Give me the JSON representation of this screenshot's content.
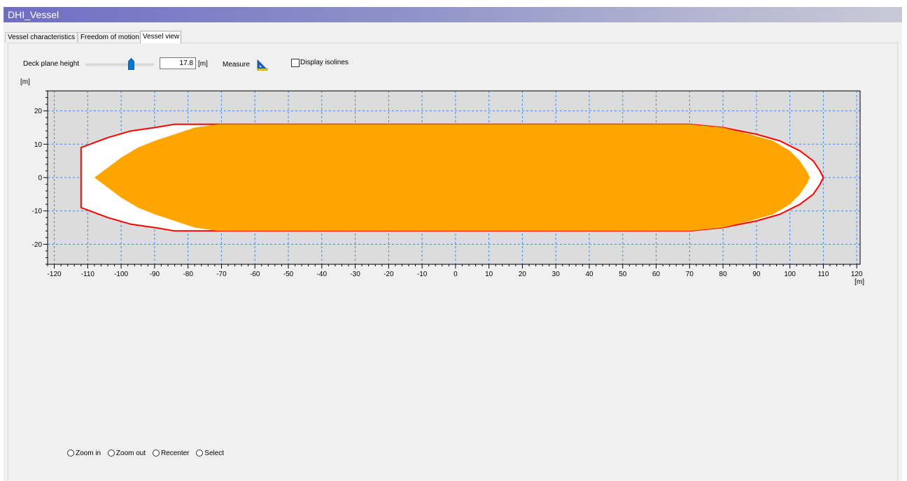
{
  "window": {
    "title": "DHI_Vessel"
  },
  "tabs": [
    {
      "label": "Vessel characteristics",
      "active": false
    },
    {
      "label": "Freedom of motion",
      "active": false
    },
    {
      "label": "Vessel view",
      "active": true
    }
  ],
  "controls": {
    "deck_plane_label": "Deck plane height",
    "deck_plane_value": "17.8",
    "deck_plane_unit": "[m]",
    "measure_label": "Measure",
    "display_isolines_label": "Display isolines",
    "display_isolines_checked": false
  },
  "chart_data": {
    "type": "area",
    "x_unit": "[m]",
    "y_unit": "[m]",
    "xlim": [
      -122,
      121
    ],
    "ylim": [
      -26,
      26
    ],
    "x_ticks": [
      "-120",
      "-110",
      "-100",
      "-90",
      "-80",
      "-70",
      "-60",
      "-50",
      "-40",
      "-30",
      "-20",
      "-10",
      "0",
      "10",
      "20",
      "30",
      "40",
      "50",
      "60",
      "70",
      "80",
      "90",
      "100",
      "110",
      "120"
    ],
    "y_ticks": [
      "20",
      "10",
      "0",
      "-10",
      "-20"
    ],
    "grid": true,
    "background": "#dcdcdc",
    "outline_color": "#ff0000",
    "fill_color": "#ffa500",
    "hull_outline": [
      [
        -112,
        9
      ],
      [
        -104,
        12
      ],
      [
        -97,
        14
      ],
      [
        -90,
        15
      ],
      [
        -84,
        16
      ],
      [
        -76,
        16
      ],
      [
        -60,
        16
      ],
      [
        0,
        16
      ],
      [
        32,
        16
      ],
      [
        52,
        16
      ],
      [
        70,
        16
      ],
      [
        80,
        15
      ],
      [
        90,
        13
      ],
      [
        97,
        11
      ],
      [
        103,
        8
      ],
      [
        107,
        5
      ],
      [
        109,
        2
      ],
      [
        110,
        0
      ],
      [
        109,
        -2
      ],
      [
        107,
        -5
      ],
      [
        103,
        -8
      ],
      [
        97,
        -11
      ],
      [
        90,
        -13
      ],
      [
        80,
        -15
      ],
      [
        70,
        -16
      ],
      [
        52,
        -16
      ],
      [
        32,
        -16
      ],
      [
        0,
        -16
      ],
      [
        -60,
        -16
      ],
      [
        -76,
        -16
      ],
      [
        -84,
        -16
      ],
      [
        -90,
        -15
      ],
      [
        -97,
        -14
      ],
      [
        -104,
        -12
      ],
      [
        -112,
        -9
      ]
    ],
    "deck_section": [
      [
        -108,
        0
      ],
      [
        -104,
        3
      ],
      [
        -100,
        6
      ],
      [
        -95,
        9
      ],
      [
        -90,
        11
      ],
      [
        -84,
        13
      ],
      [
        -78,
        15
      ],
      [
        -71,
        16
      ],
      [
        0,
        16
      ],
      [
        32,
        16
      ],
      [
        52,
        16
      ],
      [
        70,
        16
      ],
      [
        80,
        15
      ],
      [
        88,
        13
      ],
      [
        95,
        11
      ],
      [
        100,
        8
      ],
      [
        103,
        5
      ],
      [
        105,
        2
      ],
      [
        106,
        0
      ],
      [
        105,
        -2
      ],
      [
        103,
        -5
      ],
      [
        100,
        -8
      ],
      [
        95,
        -11
      ],
      [
        88,
        -13
      ],
      [
        80,
        -15
      ],
      [
        70,
        -16
      ],
      [
        52,
        -16
      ],
      [
        32,
        -16
      ],
      [
        0,
        -16
      ],
      [
        -71,
        -16
      ],
      [
        -78,
        -15
      ],
      [
        -84,
        -13
      ],
      [
        -90,
        -11
      ],
      [
        -95,
        -9
      ],
      [
        -100,
        -6
      ],
      [
        -104,
        -3
      ]
    ]
  },
  "view_modes": [
    {
      "label": "Zoom in",
      "selected": false
    },
    {
      "label": "Zoom out",
      "selected": false
    },
    {
      "label": "Recenter",
      "selected": false
    },
    {
      "label": "Select",
      "selected": false
    }
  ]
}
